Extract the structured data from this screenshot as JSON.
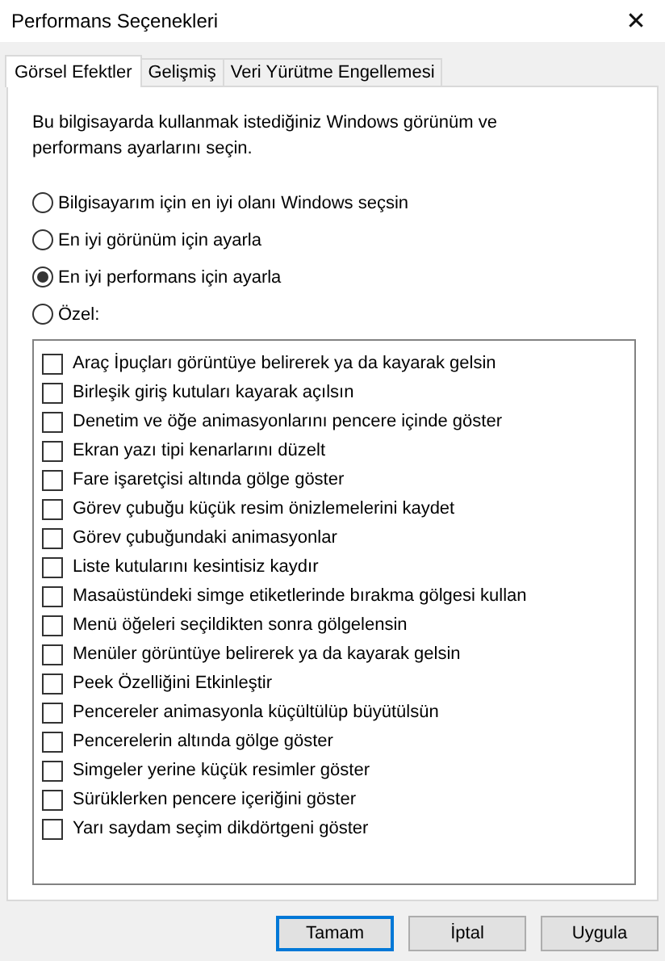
{
  "window": {
    "title": "Performans Seçenekleri",
    "close": "✕"
  },
  "tabs": [
    {
      "label": "Görsel Efektler",
      "selected": true
    },
    {
      "label": "Gelişmiş",
      "selected": false
    },
    {
      "label": "Veri Yürütme Engellemesi",
      "selected": false
    }
  ],
  "description": "Bu bilgisayarda kullanmak istediğiniz Windows görünüm ve performans ayarlarını seçin.",
  "options": [
    {
      "label": "Bilgisayarım için en iyi olanı Windows seçsin",
      "selected": false
    },
    {
      "label": "En iyi görünüm için ayarla",
      "selected": false
    },
    {
      "label": "En iyi performans için ayarla",
      "selected": true
    },
    {
      "label": "Özel:",
      "selected": false
    }
  ],
  "effects": [
    {
      "label": "Araç İpuçları görüntüye belirerek ya da kayarak gelsin",
      "checked": false
    },
    {
      "label": "Birleşik giriş kutuları kayarak açılsın",
      "checked": false
    },
    {
      "label": "Denetim ve öğe animasyonlarını pencere içinde göster",
      "checked": false
    },
    {
      "label": "Ekran yazı tipi kenarlarını düzelt",
      "checked": false
    },
    {
      "label": "Fare işaretçisi altında gölge göster",
      "checked": false
    },
    {
      "label": "Görev çubuğu küçük resim önizlemelerini kaydet",
      "checked": false
    },
    {
      "label": "Görev çubuğundaki animasyonlar",
      "checked": false
    },
    {
      "label": "Liste kutularını kesintisiz kaydır",
      "checked": false
    },
    {
      "label": "Masaüstündeki simge etiketlerinde bırakma gölgesi kullan",
      "checked": false
    },
    {
      "label": "Menü öğeleri seçildikten sonra gölgelensin",
      "checked": false
    },
    {
      "label": "Menüler görüntüye belirerek ya da kayarak gelsin",
      "checked": false
    },
    {
      "label": "Peek Özelliğini Etkinleştir",
      "checked": false
    },
    {
      "label": "Pencereler animasyonla küçültülüp büyütülsün",
      "checked": false
    },
    {
      "label": "Pencerelerin altında gölge göster",
      "checked": false
    },
    {
      "label": "Simgeler yerine küçük resimler göster",
      "checked": false
    },
    {
      "label": "Sürüklerken pencere içeriğini göster",
      "checked": false
    },
    {
      "label": "Yarı saydam seçim dikdörtgeni göster",
      "checked": false
    }
  ],
  "buttons": [
    {
      "label": "Tamam",
      "default": true
    },
    {
      "label": "İptal",
      "default": false
    },
    {
      "label": "Uygula",
      "default": false
    }
  ]
}
